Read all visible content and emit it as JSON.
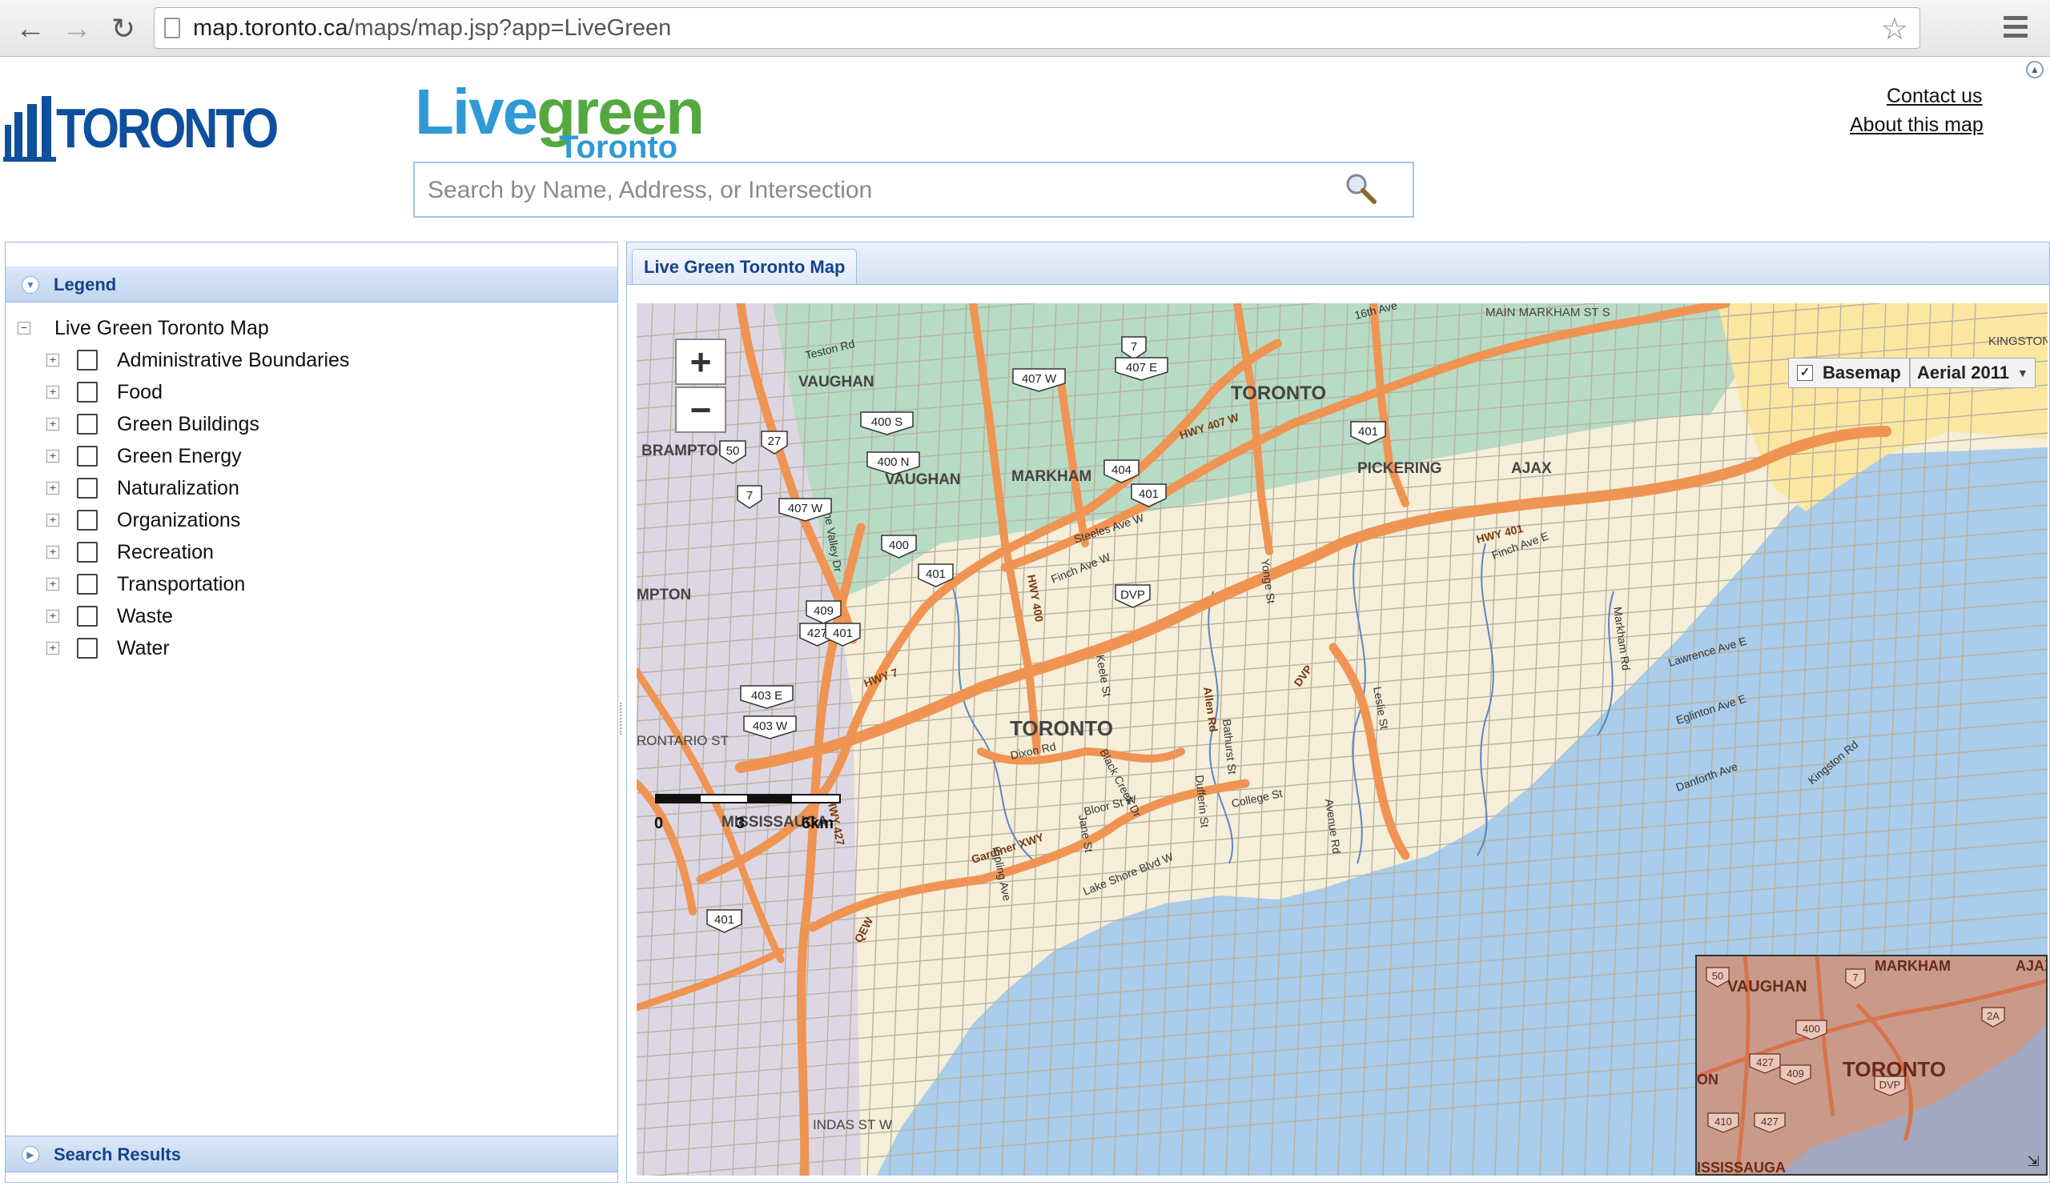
{
  "browser": {
    "url_host": "map.toronto.ca",
    "url_path": "/maps/map.jsp?app=LiveGreen",
    "back_icon": "back-arrow-icon",
    "forward_icon": "forward-arrow-icon",
    "reload_icon": "reload-icon",
    "bookmark_icon": "star-icon",
    "menu_icon": "hamburger-menu-icon"
  },
  "header": {
    "city_logo_text": "TORONTO",
    "brand_live": "Live",
    "brand_green": "green",
    "brand_toronto": "Toronto",
    "search_placeholder": "Search by Name, Address, or Intersection",
    "search_value": "",
    "contact_label": "Contact us",
    "about_label": "About this map"
  },
  "legend_panel": {
    "title": "Legend",
    "root_label": "Live Green Toronto Map",
    "layers": [
      {
        "label": "Administrative Boundaries",
        "checked": false
      },
      {
        "label": "Food",
        "checked": false
      },
      {
        "label": "Green Buildings",
        "checked": false
      },
      {
        "label": "Green Energy",
        "checked": false
      },
      {
        "label": "Naturalization",
        "checked": false
      },
      {
        "label": "Organizations",
        "checked": false
      },
      {
        "label": "Recreation",
        "checked": false
      },
      {
        "label": "Transportation",
        "checked": false
      },
      {
        "label": "Waste",
        "checked": false
      },
      {
        "label": "Water",
        "checked": false
      }
    ]
  },
  "search_results_panel": {
    "title": "Search Results"
  },
  "map_panel": {
    "tab_label": "Live Green Toronto Map",
    "zoom_in": "+",
    "zoom_out": "−",
    "basemap_label": "Basemap",
    "basemap_checked": true,
    "aerial_option": "Aerial 2011",
    "scale_labels": [
      "0",
      "3",
      "6km"
    ],
    "place_labels": [
      "VAUGHAN",
      "VAUGHAN",
      "MARKHAM",
      "TORONTO",
      "TORONTO",
      "PICKERING",
      "AJAX",
      "BRAMPTON",
      "MPTON",
      "MISSISSAUGA",
      "KINGSTON",
      "MAIN MARKHAM ST S",
      "RONTARIO ST",
      "INDAS ST W"
    ],
    "road_labels": [
      "HWY 401",
      "HWY 400",
      "HWY 427",
      "HWY 7",
      "HWY 407 W",
      "Gardiner XWY",
      "DVP",
      "QEW",
      "Steeles Ave W",
      "Finch Ave W",
      "Finch Ave E",
      "Lawrence Ave E",
      "Eglinton Ave E",
      "Dixon Rd",
      "Bloor St W",
      "College St",
      "Danforth Ave",
      "Lake Shore Blvd W",
      "Kingston Rd",
      "Yonge St",
      "Allen Rd",
      "Keele St",
      "Jane St",
      "Dufferin St",
      "Bathurst St",
      "Avenue Rd",
      "Kipling Ave",
      "Black Creek Dr",
      "Leslie St",
      "Markham Rd",
      "Teston Rd",
      "16th Ave",
      "Pine Valley Dr"
    ],
    "shields": [
      "7",
      "407 E",
      "407 W",
      "400 S",
      "400 N",
      "27",
      "50",
      "7",
      "407 W",
      "404",
      "401",
      "400",
      "401",
      "DVP",
      "409",
      "427",
      "401",
      "401",
      "403 E",
      "403 W",
      "401"
    ],
    "overview_labels": [
      "VAUGHAN",
      "MARKHAM",
      "AJAX",
      "TORONTO",
      "ON",
      "ISSISSAUGA"
    ],
    "overview_shields": [
      "50",
      "7",
      "400",
      "427",
      "409",
      "DVP",
      "410",
      "427",
      "2A"
    ],
    "colors": {
      "lake": "#a9cdea",
      "land": "#f5eed8",
      "york_region": "#b7dbc4",
      "peel_region": "#ddd7e3",
      "durham_region": "#fbe7a1",
      "highway": "#ef9453",
      "minor_road": "#b9b2a2",
      "overview_bg": "#c9a496"
    }
  }
}
